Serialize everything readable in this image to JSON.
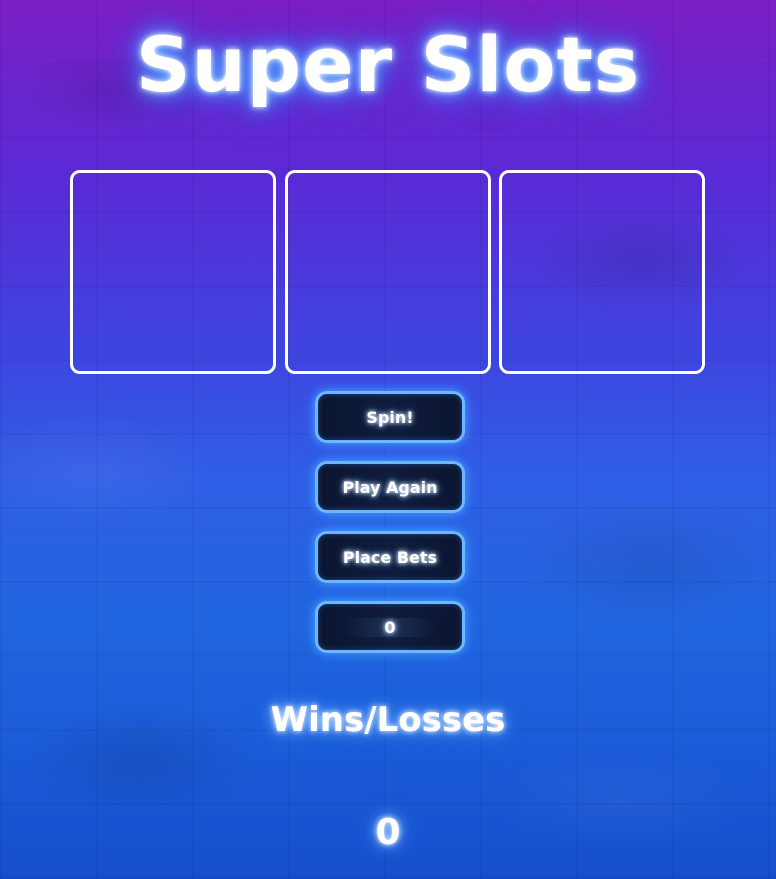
{
  "title": "Super Slots",
  "reels": [
    "",
    "",
    ""
  ],
  "buttons": {
    "spin": "Spin!",
    "play_again": "Play Again",
    "place_bets": "Place Bets"
  },
  "bet": {
    "value": "0"
  },
  "results": {
    "label": "Wins/Losses",
    "value": "0"
  },
  "colors": {
    "background_top": "#7a1fc4",
    "background_bottom": "#164fcc",
    "button_border": "#6fb6ff",
    "button_fill": "#0b1530",
    "glow": "#3a8dff"
  }
}
